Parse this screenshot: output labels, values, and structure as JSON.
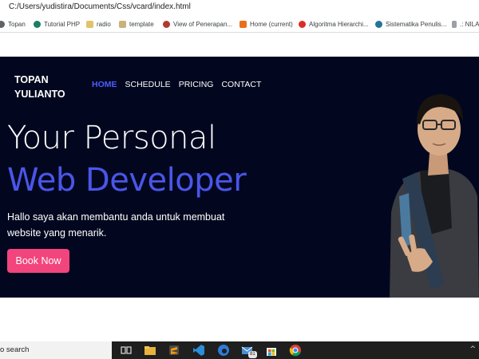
{
  "browser": {
    "url": "C:/Users/yudistira/Documents/Css/vcard/index.html",
    "bookmarks": [
      {
        "label": "Topan",
        "icon": "globe-icon"
      },
      {
        "label": "Tutorial PHP",
        "icon": "site-icon"
      },
      {
        "label": "radio",
        "icon": "folder-icon"
      },
      {
        "label": "template",
        "icon": "folder-icon"
      },
      {
        "label": "View of Penerapan...",
        "icon": "site-icon"
      },
      {
        "label": "Home (current)",
        "icon": "site-icon"
      },
      {
        "label": "Algoritma Hierarchi...",
        "icon": "info-icon"
      },
      {
        "label": "Sistematika Penulis...",
        "icon": "wordpress-icon"
      },
      {
        "label": ".: NILA",
        "icon": "site-icon"
      }
    ]
  },
  "site": {
    "brand": "TOPAN YULIANTO",
    "nav": [
      "HOME",
      "SCHEDULE",
      "PRICING",
      "CONTACT"
    ],
    "headline_line1": "Your Personal",
    "headline_line2": "Web Developer",
    "description": "Hallo saya akan membantu anda untuk membuat website yang menarik.",
    "cta": "Book Now",
    "colors": {
      "background": "#02071f",
      "accent": "#4a56e8",
      "nav_active": "#4b5dff",
      "button": "#f2447d"
    }
  },
  "taskbar": {
    "search_text": "o search",
    "mail_badge": "81",
    "icons": [
      "task-view-icon",
      "file-explorer-icon",
      "sublime-text-icon",
      "vscode-icon",
      "edge-icon",
      "mail-icon",
      "store-icon",
      "chrome-icon"
    ],
    "tray": "^"
  }
}
